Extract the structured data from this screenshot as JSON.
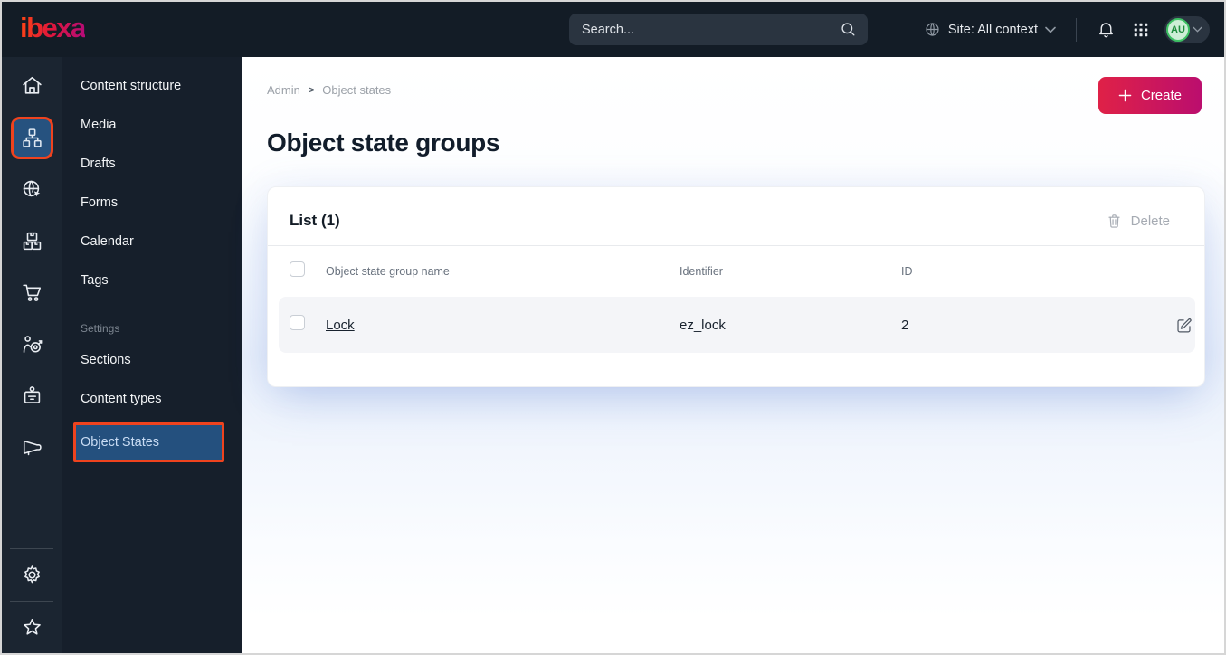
{
  "topbar": {
    "logo_text": "ibexa",
    "search": {
      "placeholder": "Search..."
    },
    "site_context_label": "Site: All context",
    "avatar_initials": "AU"
  },
  "sidebar": {
    "rail_icons": [
      "home",
      "content-structure",
      "site",
      "product-catalog",
      "commerce",
      "personalization",
      "customers",
      "marketing",
      "settings",
      "bookmarks"
    ],
    "active_rail_icon": "content-structure",
    "menu_items": [
      "Content structure",
      "Media",
      "Drafts",
      "Forms",
      "Calendar",
      "Tags"
    ],
    "settings_header": "Settings",
    "settings_items": [
      "Sections",
      "Content types",
      "Object States"
    ],
    "active_item": "Object States"
  },
  "main": {
    "breadcrumb": {
      "items": [
        "Admin",
        "Object states"
      ],
      "separator": ">"
    },
    "create_button": "Create",
    "page_title": "Object state groups",
    "list_card": {
      "title": "List (1)",
      "delete_button": "Delete",
      "columns": {
        "name": "Object state group name",
        "identifier": "Identifier",
        "id": "ID"
      },
      "rows": [
        {
          "name": "Lock",
          "identifier": "ez_lock",
          "id": "2"
        }
      ]
    }
  },
  "colors": {
    "topbar_bg": "#131c26",
    "sidebar_bg": "#161f2b",
    "active_blue": "#24507e",
    "accent_orange": "#ef431e",
    "create_gradient_start": "#df2147",
    "create_gradient_end": "#bb0e6e",
    "brand_gradient": [
      "#ff4713",
      "#e0173b",
      "#b30b7c"
    ],
    "avatar_green": "#3ec164",
    "row_bg": "#f4f5f8"
  }
}
